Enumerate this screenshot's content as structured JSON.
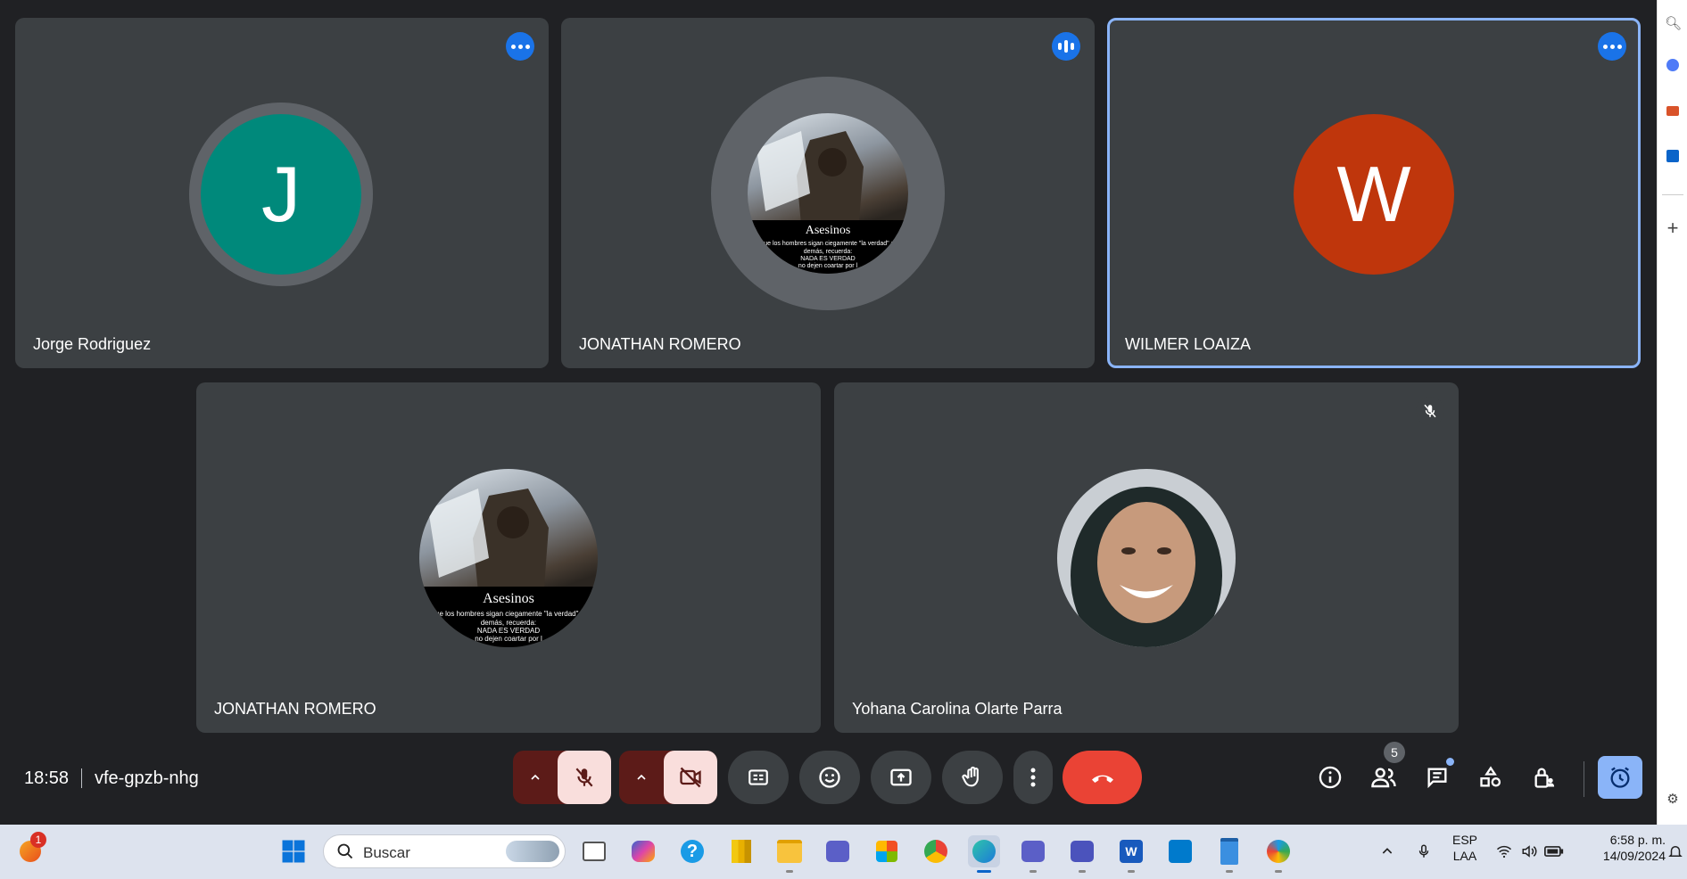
{
  "participants": [
    {
      "name": "Jorge Rodriguez",
      "initial": "J",
      "color": "#00897b",
      "status": "more-options"
    },
    {
      "name": "JONATHAN ROMERO",
      "status": "speaking"
    },
    {
      "name": "WILMER LOAIZA",
      "initial": "W",
      "color": "#bf360c",
      "status": "more-options",
      "active": true
    },
    {
      "name": "JONATHAN ROMERO",
      "status": "none"
    },
    {
      "name": "Yohana Carolina Olarte Parra",
      "status": "muted"
    }
  ],
  "profile_image_text": {
    "title": "Asesinos",
    "line1": "que los hombres sigan ciegamente \"la verdad\" si",
    "line2": "demás, recuerda:",
    "line3": "NADA ES VERDAD",
    "line4": "no dejen coartar por l"
  },
  "meeting": {
    "time": "18:58",
    "code": "vfe-gpzb-nhg",
    "participant_count": "5"
  },
  "controls": {
    "mic_state": "muted",
    "camera_state": "off",
    "end_call_color": "#d93025",
    "accent": "#8ab4f8"
  },
  "taskbar": {
    "search_placeholder": "Buscar",
    "notification_count": "1",
    "language": "ESP",
    "layout": "LAA",
    "time": "6:58 p. m.",
    "date": "14/09/2024"
  }
}
